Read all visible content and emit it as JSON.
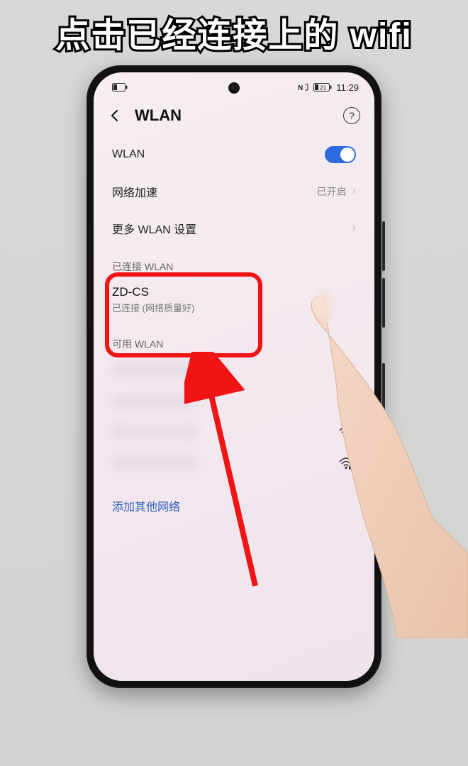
{
  "caption": "点击已经连接上的 wifi",
  "statusbar": {
    "battery_icon": "battery",
    "nfc_icon": "NFC",
    "battery_pct": "21",
    "time": "11:29"
  },
  "header": {
    "back_icon": "back",
    "title": "WLAN",
    "help_icon": "?"
  },
  "rows": {
    "wlan_label": "WLAN",
    "accel_label": "网络加速",
    "accel_value": "已开启",
    "more_label": "更多 WLAN 设置"
  },
  "connected": {
    "section": "已连接 WLAN",
    "ssid": "ZD-CS",
    "status": "已连接 (网络质量好)"
  },
  "available": {
    "section": "可用 WLAN"
  },
  "add_network": "添加其他网络",
  "annotations": {
    "highlight_target": "connected-network",
    "arrow_color": "#f01414"
  }
}
